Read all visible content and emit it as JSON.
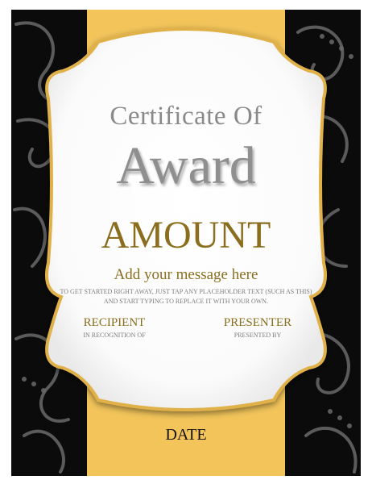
{
  "certificate": {
    "heading": "Certificate Of",
    "title": "Award",
    "amount": "AMOUNT",
    "message": "Add your message here",
    "instructions": "TO GET STARTED RIGHT AWAY, JUST TAP ANY PLACEHOLDER TEXT (SUCH AS THIS) AND START TYPING TO REPLACE IT WITH YOUR OWN.",
    "recipient_label": "RECIPIENT",
    "recipient_caption": "IN RECOGNITION OF",
    "presenter_label": "PRESENTER",
    "presenter_caption": "PRESENTED BY",
    "date_label": "DATE"
  },
  "colors": {
    "background": "#0b0b0b",
    "band": "#f2c45a",
    "frame_border": "#e0b14a",
    "gold_text": "#8a6e1e",
    "grey_text": "#8a8a8a"
  }
}
